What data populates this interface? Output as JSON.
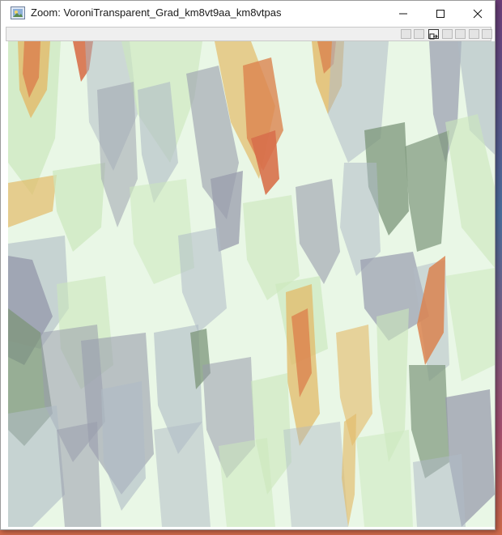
{
  "window": {
    "title": "Zoom: VoroniTransparent_Grad_km8vt9aa_km8vtpas",
    "minimize_icon": "minimize-icon",
    "maximize_icon": "maximize-icon",
    "close_icon": "close-icon"
  },
  "toolbar": {
    "tools": [
      {
        "icon": "zoom-fit-icon",
        "active": false
      },
      {
        "icon": "zoom-reset-icon",
        "active": false
      },
      {
        "icon": "export-icon",
        "active": true
      },
      {
        "icon": "scroll-up-icon",
        "active": false
      },
      {
        "icon": "scroll-down-icon",
        "active": false
      },
      {
        "icon": "grid-icon",
        "active": false
      },
      {
        "icon": "settings-icon",
        "active": false
      }
    ]
  },
  "canvas": {
    "image_name": "VoroniTransparent_Grad_km8vt9aa_km8vtpas",
    "palette": [
      "#e9f7e6",
      "#c8e6b8",
      "#a9b4c2",
      "#8f92a6",
      "#6f8a6e",
      "#e2b35a",
      "#d9773f",
      "#d6603a"
    ]
  }
}
